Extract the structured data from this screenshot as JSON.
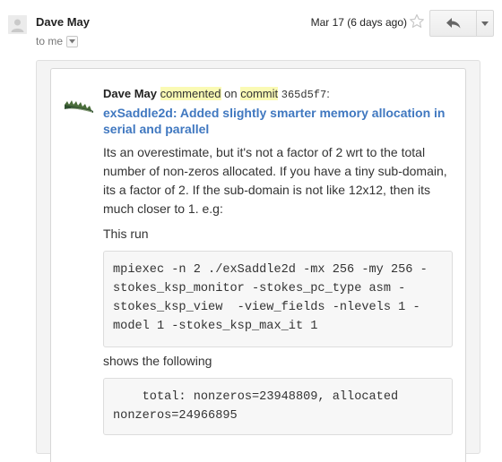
{
  "header": {
    "sender": "Dave May",
    "to_label": "to me",
    "date": "Mar 17 (6 days ago)"
  },
  "card": {
    "author": "Dave May",
    "action_word": "commented",
    "on_word": "on",
    "commit_word": "commit",
    "commit_hash": "365d5f7",
    "colon": ":",
    "title": "exSaddle2d: Added slightly smarter memory allocation in serial and parallel",
    "body_paragraph": "Its an overestimate, but it's not a factor of 2 wrt to the total number of non-zeros allocated. If you have a tiny sub-domain, its a factor of 2. If the sub-domain is not like 12x12, then its much closer to 1. e.g:",
    "this_run": "This run",
    "command": "mpiexec -n 2 ./exSaddle2d -mx 256 -my 256 -stokes_ksp_monitor -stokes_pc_type asm -stokes_ksp_view  -view_fields -nlevels 1 -model 1 -stokes_ksp_max_it 1",
    "shows_following": "shows the following",
    "output": "    total: nonzeros=23948809, allocated nonzeros=24966895"
  },
  "icons": {
    "avatar": "default-person-icon",
    "star": "star-outline-icon",
    "reply": "reply-arrow-icon",
    "more": "chevron-down-icon",
    "github_avatar": "commenter-avatar-icon"
  },
  "colors": {
    "link": "#4078c0",
    "highlight": "#fafab4"
  }
}
